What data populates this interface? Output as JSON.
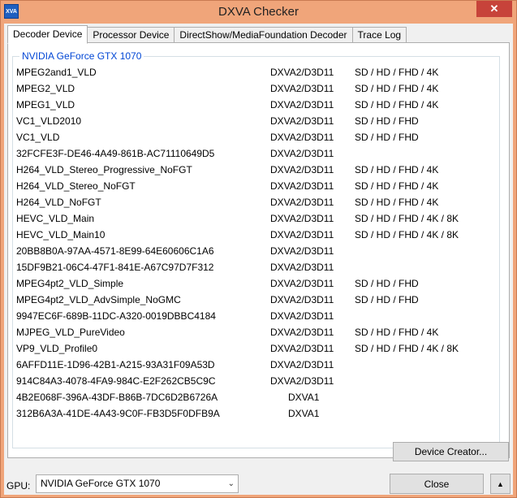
{
  "window": {
    "title": "DXVA Checker",
    "icon_text": "XVA",
    "close_glyph": "✕"
  },
  "tabs": [
    {
      "label": "Decoder Device",
      "active": true
    },
    {
      "label": "Processor Device",
      "active": false
    },
    {
      "label": "DirectShow/MediaFoundation Decoder",
      "active": false
    },
    {
      "label": "Trace Log",
      "active": false
    }
  ],
  "group": {
    "label": "NVIDIA GeForce GTX 1070"
  },
  "decoders": [
    {
      "name": "MPEG2and1_VLD",
      "api": "DXVA2/D3D11",
      "res": "SD / HD / FHD / 4K"
    },
    {
      "name": "MPEG2_VLD",
      "api": "DXVA2/D3D11",
      "res": "SD / HD / FHD / 4K"
    },
    {
      "name": "MPEG1_VLD",
      "api": "DXVA2/D3D11",
      "res": "SD / HD / FHD / 4K"
    },
    {
      "name": "VC1_VLD2010",
      "api": "DXVA2/D3D11",
      "res": "SD / HD / FHD"
    },
    {
      "name": "VC1_VLD",
      "api": "DXVA2/D3D11",
      "res": "SD / HD / FHD"
    },
    {
      "name": "32FCFE3F-DE46-4A49-861B-AC71110649D5",
      "api": "DXVA2/D3D11",
      "res": ""
    },
    {
      "name": "H264_VLD_Stereo_Progressive_NoFGT",
      "api": "DXVA2/D3D11",
      "res": "SD / HD / FHD / 4K"
    },
    {
      "name": "H264_VLD_Stereo_NoFGT",
      "api": "DXVA2/D3D11",
      "res": "SD / HD / FHD / 4K"
    },
    {
      "name": "H264_VLD_NoFGT",
      "api": "DXVA2/D3D11",
      "res": "SD / HD / FHD / 4K"
    },
    {
      "name": "HEVC_VLD_Main",
      "api": "DXVA2/D3D11",
      "res": "SD / HD / FHD / 4K / 8K"
    },
    {
      "name": "HEVC_VLD_Main10",
      "api": "DXVA2/D3D11",
      "res": "SD / HD / FHD / 4K / 8K"
    },
    {
      "name": "20BB8B0A-97AA-4571-8E99-64E60606C1A6",
      "api": "DXVA2/D3D11",
      "res": ""
    },
    {
      "name": "15DF9B21-06C4-47F1-841E-A67C97D7F312",
      "api": "DXVA2/D3D11",
      "res": ""
    },
    {
      "name": "MPEG4pt2_VLD_Simple",
      "api": "DXVA2/D3D11",
      "res": "SD / HD / FHD"
    },
    {
      "name": "MPEG4pt2_VLD_AdvSimple_NoGMC",
      "api": "DXVA2/D3D11",
      "res": "SD / HD / FHD"
    },
    {
      "name": "9947EC6F-689B-11DC-A320-0019DBBC4184",
      "api": "DXVA2/D3D11",
      "res": ""
    },
    {
      "name": "MJPEG_VLD_PureVideo",
      "api": "DXVA2/D3D11",
      "res": "SD / HD / FHD / 4K"
    },
    {
      "name": "VP9_VLD_Profile0",
      "api": "DXVA2/D3D11",
      "res": "SD / HD / FHD / 4K / 8K"
    },
    {
      "name": "6AFFD11E-1D96-42B1-A215-93A31F09A53D",
      "api": "DXVA2/D3D11",
      "res": ""
    },
    {
      "name": "914C84A3-4078-4FA9-984C-E2F262CB5C9C",
      "api": "DXVA2/D3D11",
      "res": ""
    },
    {
      "name": "4B2E068F-396A-43DF-B86B-7DC6D2B6726A",
      "api": "DXVA1",
      "res": ""
    },
    {
      "name": "312B6A3A-41DE-4A43-9C0F-FB3D5F0DFB9A",
      "api": "DXVA1",
      "res": ""
    }
  ],
  "buttons": {
    "device_creator": "Device Creator...",
    "close": "Close",
    "up_glyph": "▲"
  },
  "gpu": {
    "label": "GPU:",
    "selected": "NVIDIA GeForce GTX 1070",
    "arrow_glyph": "⌄"
  },
  "colors": {
    "title_bar": "#f0a57a",
    "group_label": "#0046d5",
    "close_x": "#c7433a"
  }
}
